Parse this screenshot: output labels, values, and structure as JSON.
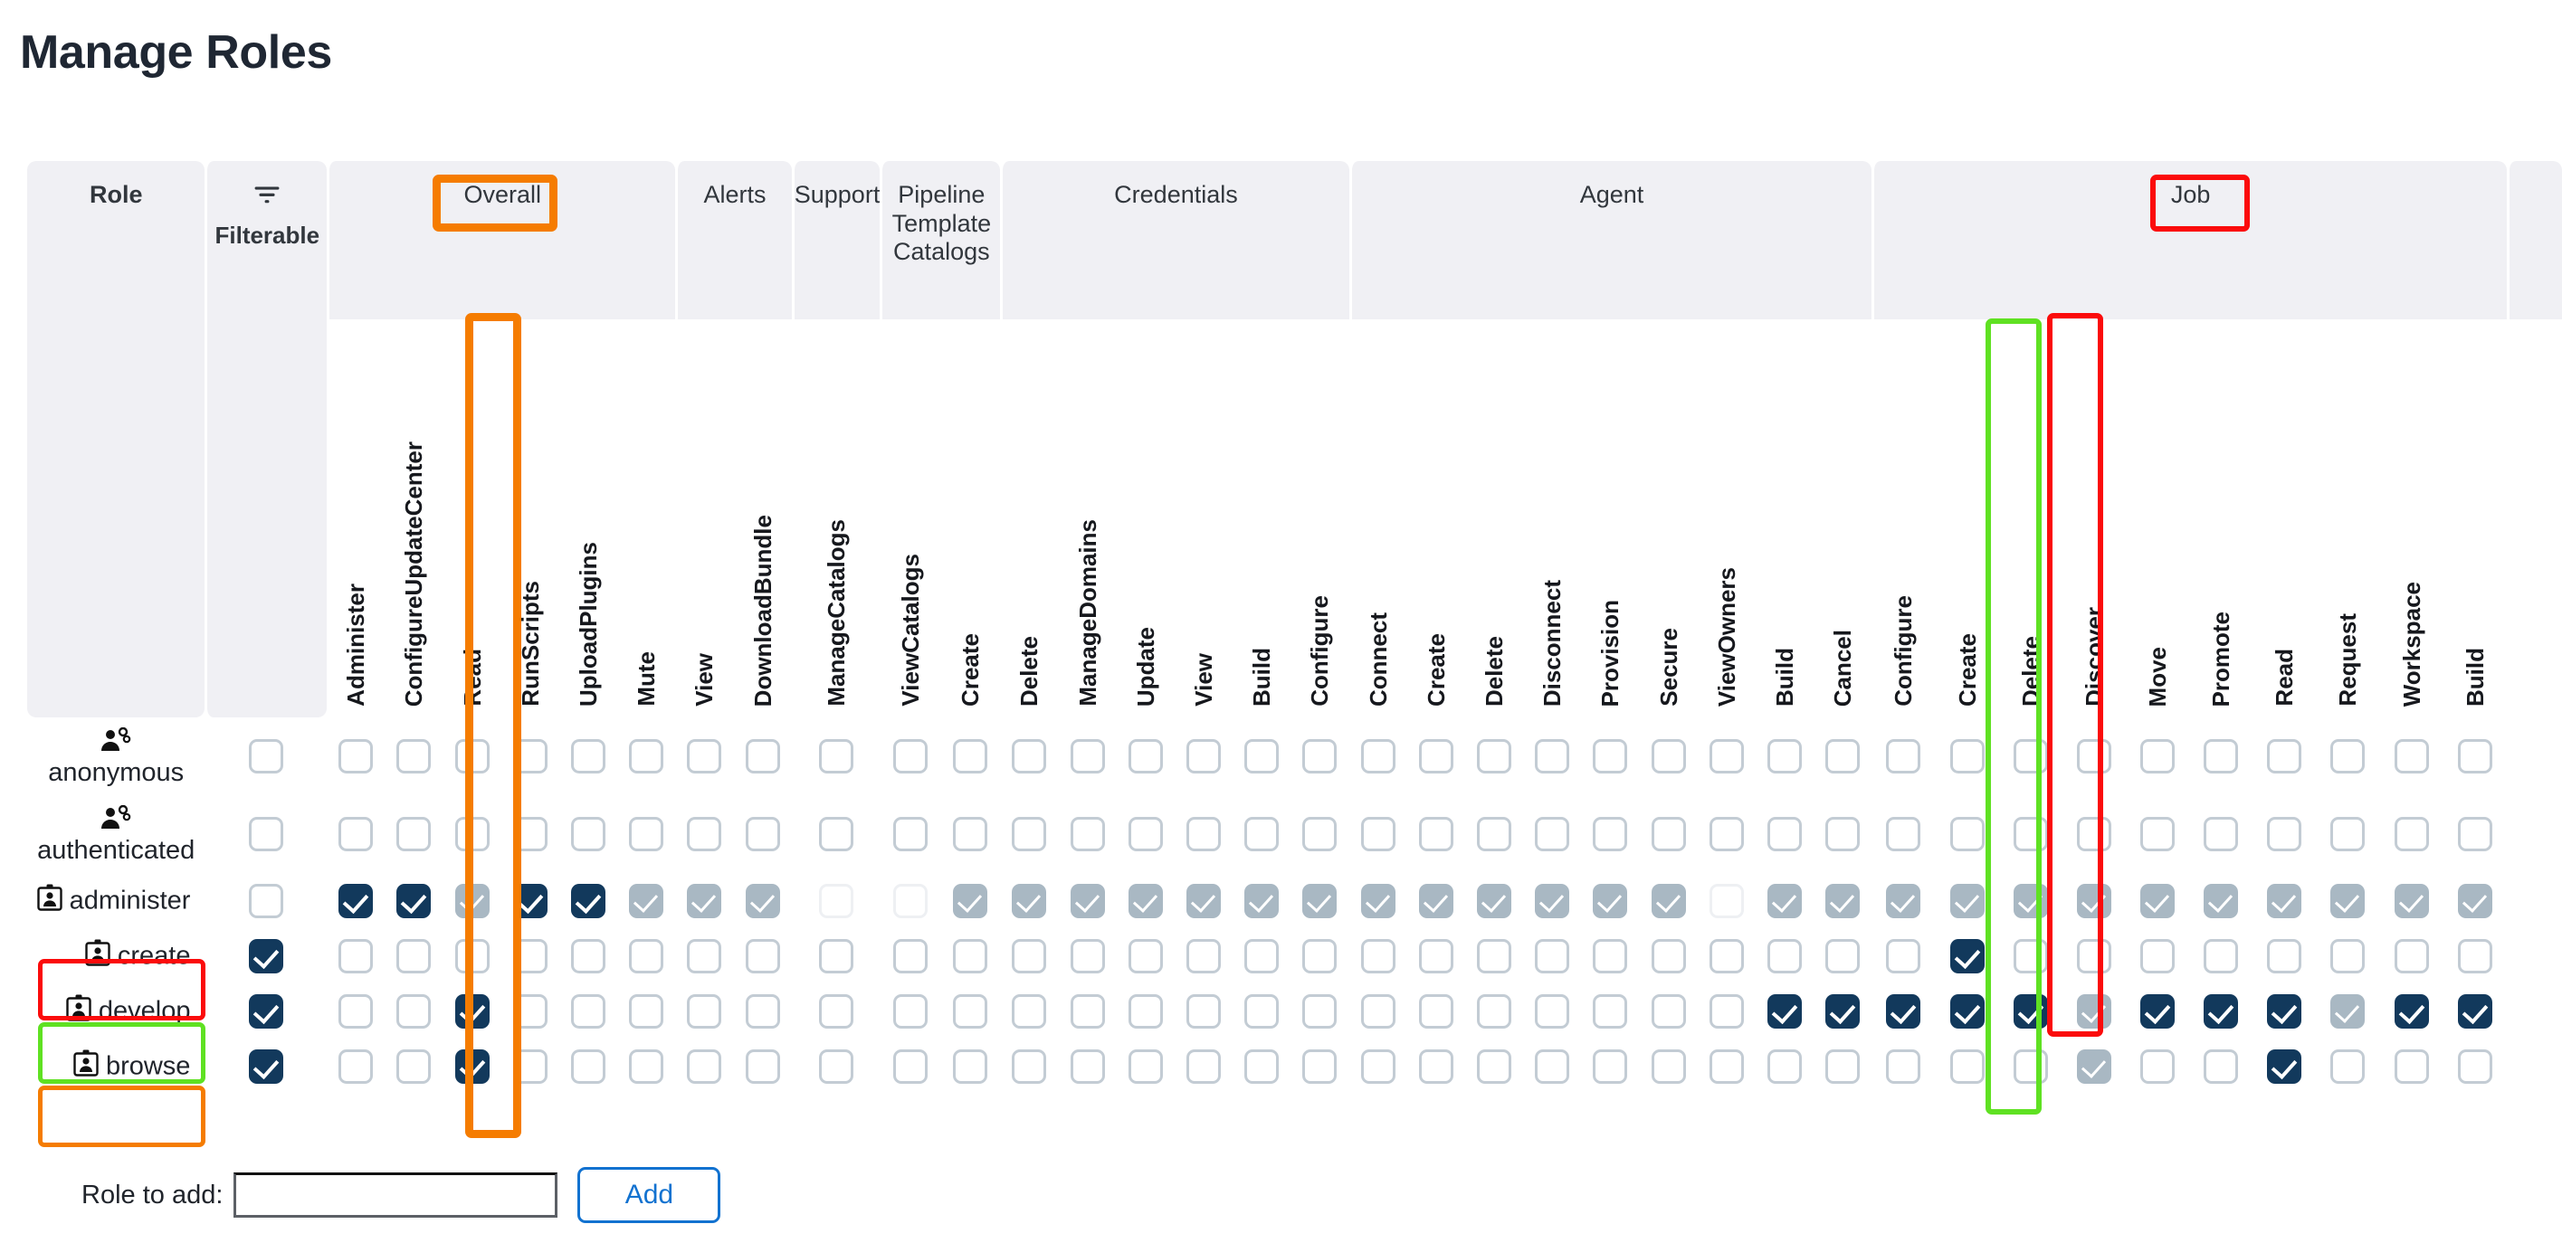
{
  "page": {
    "title": "Manage Roles"
  },
  "table": {
    "role_header": "Role",
    "filterable_header": "Filterable",
    "filter_icon": "filter-icon",
    "groups": [
      {
        "label": "Overall",
        "span": 6
      },
      {
        "label": "Alerts",
        "span": 2
      },
      {
        "label": "Support",
        "span": 1
      },
      {
        "label": "Pipeline Template Catalogs",
        "span": 2
      },
      {
        "label": "Credentials",
        "span": 6
      },
      {
        "label": "Agent",
        "span": 9
      },
      {
        "label": "Job",
        "span": 11
      },
      {
        "label": "",
        "span": 1
      }
    ],
    "permissions": [
      "Administer",
      "ConfigureUpdateCenter",
      "Read",
      "RunScripts",
      "UploadPlugins",
      "Mute",
      "View",
      "DownloadBundle",
      "ManageCatalogs",
      "ViewCatalogs",
      "Create",
      "Delete",
      "ManageDomains",
      "Update",
      "View",
      "Build",
      "Configure",
      "Connect",
      "Create",
      "Delete",
      "Disconnect",
      "Provision",
      "Secure",
      "ViewOwners",
      "Build",
      "Cancel",
      "Configure",
      "Create",
      "Delete",
      "Discover",
      "Move",
      "Promote",
      "Read",
      "Request",
      "Workspace",
      "Build"
    ],
    "roles": [
      {
        "name": "anonymous",
        "icon": "people-gear-icon",
        "layout": "stacked"
      },
      {
        "name": "authenticated",
        "icon": "people-gear-icon",
        "layout": "stacked"
      },
      {
        "name": "administer",
        "icon": "id-badge-icon",
        "layout": "inline"
      },
      {
        "name": "create",
        "icon": "id-badge-icon",
        "layout": "inline"
      },
      {
        "name": "develop",
        "icon": "id-badge-icon",
        "layout": "inline"
      },
      {
        "name": "browse",
        "icon": "id-badge-icon",
        "layout": "inline"
      }
    ],
    "filterable_states": [
      "off",
      "off",
      "off",
      "on",
      "on",
      "on"
    ],
    "cells": [
      [
        "off",
        "off",
        "off",
        "off",
        "off",
        "off",
        "off",
        "off",
        "off",
        "off",
        "off",
        "off",
        "off",
        "off",
        "off",
        "off",
        "off",
        "off",
        "off",
        "off",
        "off",
        "off",
        "off",
        "off",
        "off",
        "off",
        "off",
        "off",
        "off",
        "off",
        "off",
        "off",
        "off",
        "off",
        "off",
        "off"
      ],
      [
        "off",
        "off",
        "off",
        "off",
        "off",
        "off",
        "off",
        "off",
        "off",
        "off",
        "off",
        "off",
        "off",
        "off",
        "off",
        "off",
        "off",
        "off",
        "off",
        "off",
        "off",
        "off",
        "off",
        "off",
        "off",
        "off",
        "off",
        "off",
        "off",
        "off",
        "off",
        "off",
        "off",
        "off",
        "off",
        "off"
      ],
      [
        "on",
        "on",
        "imp",
        "on",
        "on",
        "imp",
        "imp",
        "imp",
        "off-faint",
        "off-faint",
        "imp",
        "imp",
        "imp",
        "imp",
        "imp",
        "imp",
        "imp",
        "imp",
        "imp",
        "imp",
        "imp",
        "imp",
        "imp",
        "off-faint",
        "imp",
        "imp",
        "imp",
        "imp",
        "imp",
        "imp",
        "imp",
        "imp",
        "imp",
        "imp",
        "imp",
        "imp"
      ],
      [
        "off",
        "off",
        "off",
        "off",
        "off",
        "off",
        "off",
        "off",
        "off",
        "off",
        "off",
        "off",
        "off",
        "off",
        "off",
        "off",
        "off",
        "off",
        "off",
        "off",
        "off",
        "off",
        "off",
        "off",
        "off",
        "off",
        "off",
        "on",
        "off",
        "off",
        "off",
        "off",
        "off",
        "off",
        "off",
        "off"
      ],
      [
        "off",
        "off",
        "on",
        "off",
        "off",
        "off",
        "off",
        "off",
        "off",
        "off",
        "off",
        "off",
        "off",
        "off",
        "off",
        "off",
        "off",
        "off",
        "off",
        "off",
        "off",
        "off",
        "off",
        "off",
        "on",
        "on",
        "on",
        "on",
        "on",
        "imp",
        "on",
        "on",
        "on",
        "imp",
        "on",
        "on"
      ],
      [
        "off",
        "off",
        "on",
        "off",
        "off",
        "off",
        "off",
        "off",
        "off",
        "off",
        "off",
        "off",
        "off",
        "off",
        "off",
        "off",
        "off",
        "off",
        "off",
        "off",
        "off",
        "off",
        "off",
        "off",
        "off",
        "off",
        "off",
        "off",
        "off",
        "imp",
        "off",
        "off",
        "on",
        "off",
        "off",
        "off"
      ]
    ]
  },
  "footer": {
    "role_to_add_label": "Role to add:",
    "role_to_add_value": "",
    "role_to_add_placeholder": "",
    "add_button": "Add"
  },
  "annotations": {
    "orange": "#f57c00",
    "red": "#fb0b0b",
    "green": "#5fe122"
  }
}
